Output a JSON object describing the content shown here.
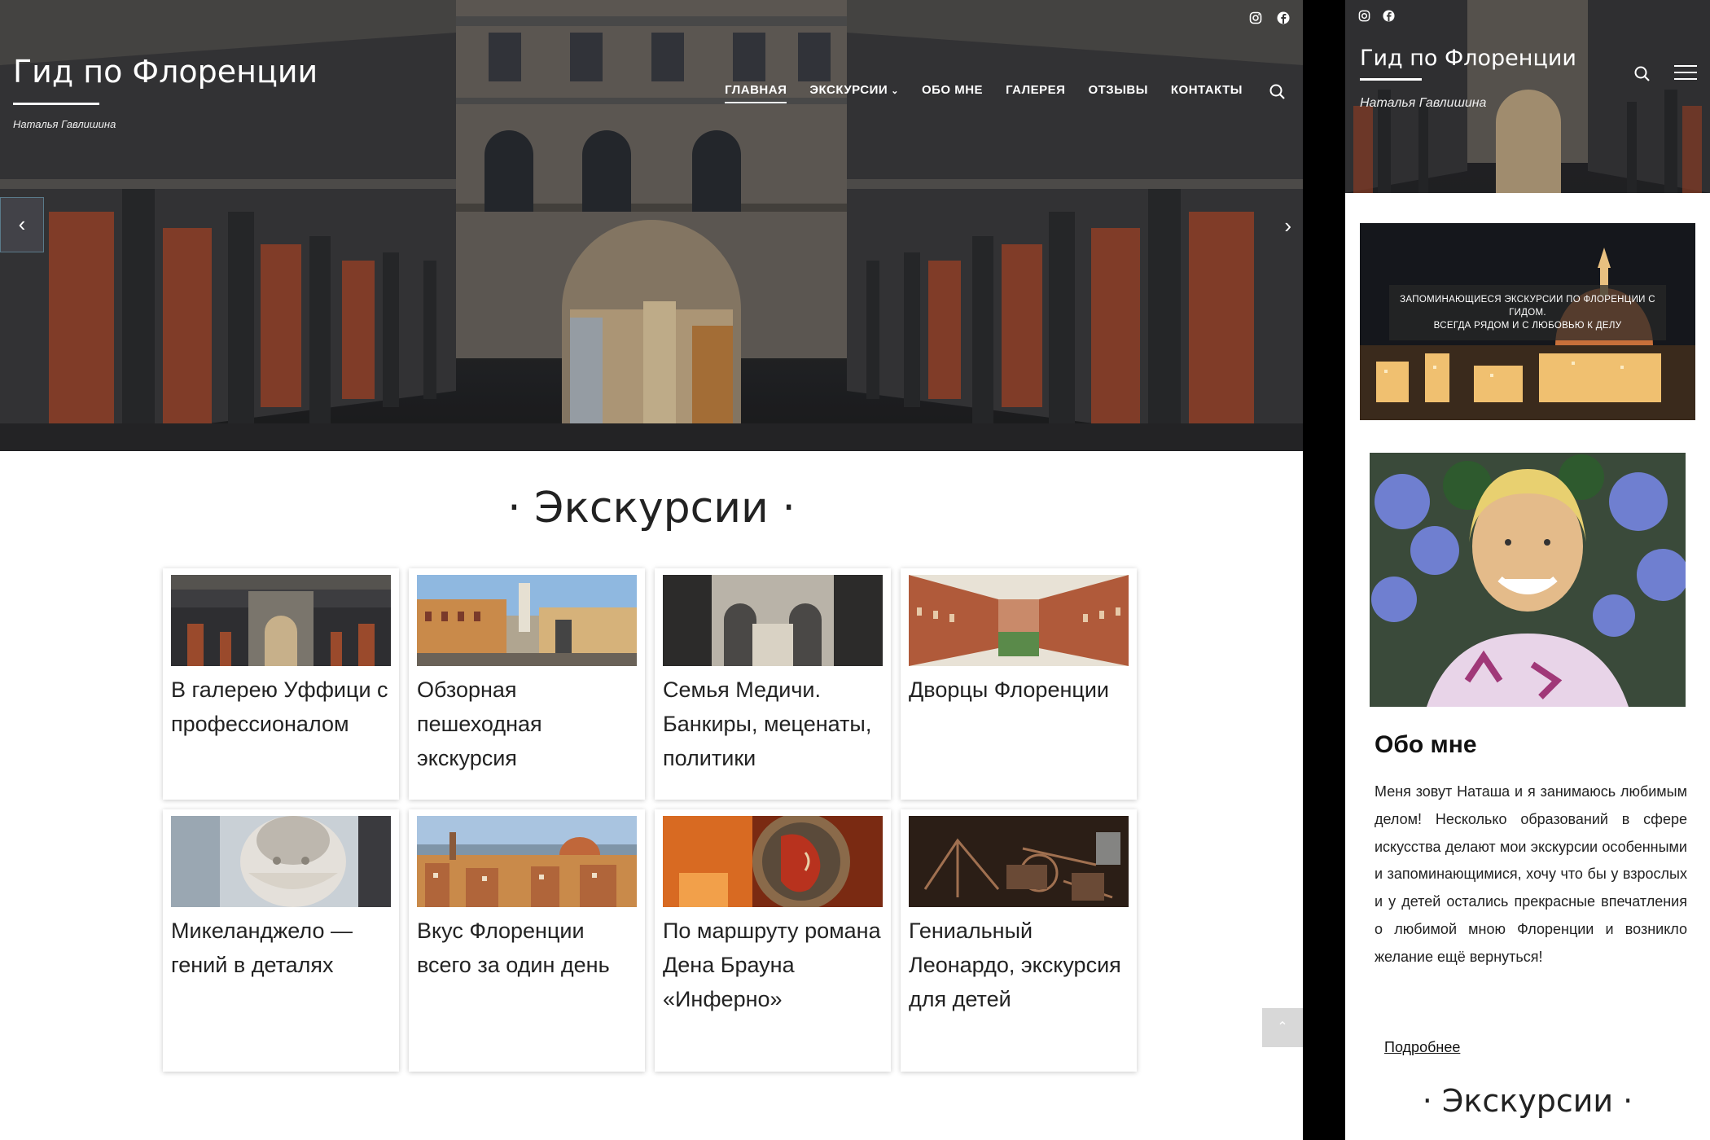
{
  "site": {
    "title": "Гид по Флоренции",
    "subtitle": "Наталья Гавлишина"
  },
  "social": [
    "instagram-icon",
    "facebook-icon"
  ],
  "nav": {
    "items": [
      {
        "label": "ГЛАВНАЯ",
        "active": true
      },
      {
        "label": "ЭКСКУРСИИ",
        "dropdown": true
      },
      {
        "label": "ОБО МНЕ"
      },
      {
        "label": "ГАЛЕРЕЯ"
      },
      {
        "label": "ОТЗЫВЫ"
      },
      {
        "label": "КОНТАКТЫ"
      }
    ]
  },
  "slider": {
    "prev_icon": "‹",
    "next_icon": "›"
  },
  "section": {
    "title": "· Экскурсии ·"
  },
  "tours": [
    {
      "title": "В галерею  Уффици с профессионалом",
      "thumb": "uffizi"
    },
    {
      "title": "Обзорная пешеходная экскурсия",
      "thumb": "piazza"
    },
    {
      "title": "Семья Медичи. Банкиры, меценаты, политики",
      "thumb": "courtyard"
    },
    {
      "title": "Дворцы Флоренции",
      "thumb": "palace"
    },
    {
      "title": "Микеланджело — гений в деталях",
      "thumb": "david"
    },
    {
      "title": "Вкус Флоренции всего за один день",
      "thumb": "panorama"
    },
    {
      "title": "По маршруту романа Дена Брауна «Инферно»",
      "thumb": "dante"
    },
    {
      "title": "Гениальный Леонардо, экскурсия для детей",
      "thumb": "leonardo"
    }
  ],
  "back_to_top": "⌃",
  "mobile": {
    "banner": {
      "line1": "ЗАПОМИНАЮЩИЕСЯ ЭКСКУРСИИ ПО ФЛОРЕНЦИИ С ГИДОМ.",
      "line2": "ВСЕГДА РЯДОМ И С ЛЮБОВЬЮ К ДЕЛУ"
    },
    "about": {
      "title": "Обо мне",
      "text": "Меня зовут Наташа и я занимаюсь любимым делом! Несколько образований в сфере искусства делают мои экскурсии особенными и запоминающимися, хочу что бы у взрослых и у детей остались прекрасные впечатления о любимой мною Флоренции и возникло желание ещё вернуться!",
      "more": "Подробнее"
    },
    "section_title": "· Экскурсии ·"
  }
}
